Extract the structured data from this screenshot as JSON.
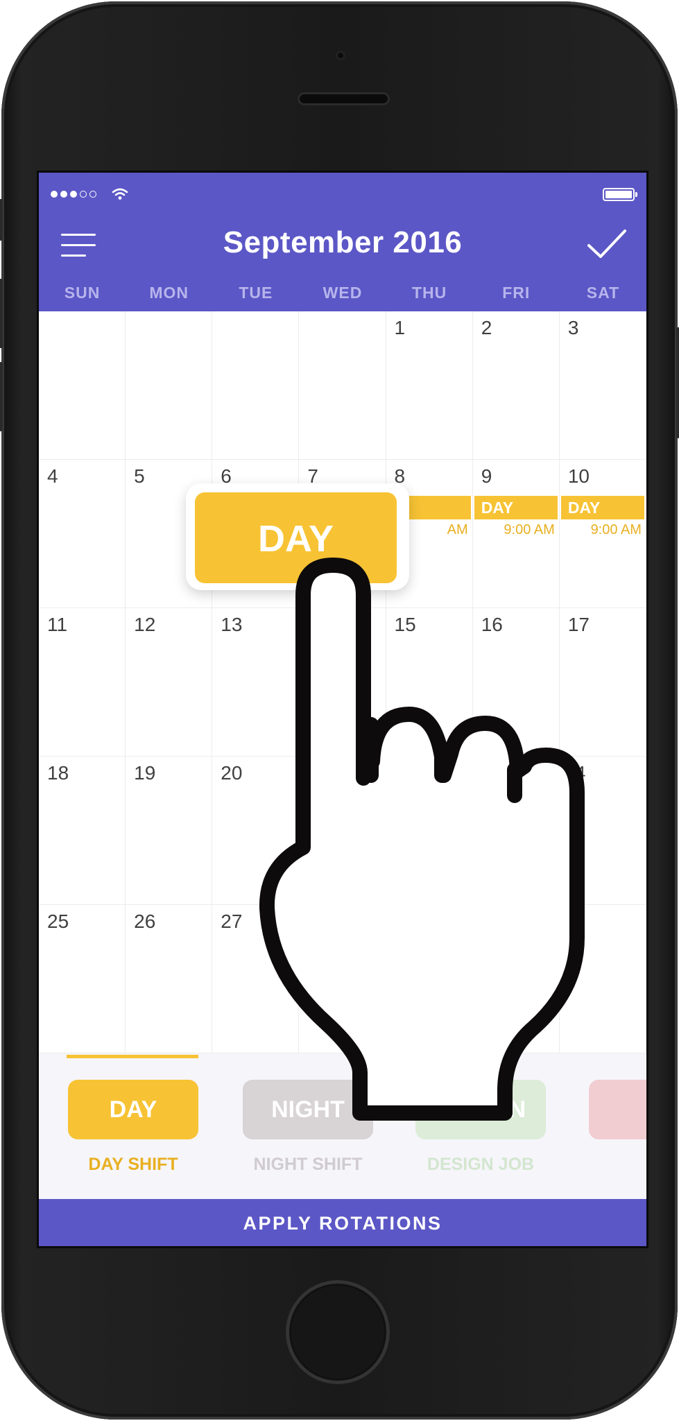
{
  "header": {
    "title": "September 2016",
    "weekdays": [
      "SUN",
      "MON",
      "TUE",
      "WED",
      "THU",
      "FRI",
      "SAT"
    ],
    "menu_icon": "hamburger-menu-icon",
    "confirm_icon": "checkmark-icon"
  },
  "status_bar": {
    "signal_icon": "signal-dots-icon",
    "wifi_icon": "wifi-icon",
    "battery_icon": "battery-icon",
    "battery_level": 1.0
  },
  "calendar": {
    "weeks": [
      [
        "",
        "",
        "",
        "",
        "1",
        "2",
        "3"
      ],
      [
        "4",
        "5",
        "6",
        "7",
        "8",
        "9",
        "10"
      ],
      [
        "11",
        "12",
        "13",
        "",
        "15",
        "16",
        "17"
      ],
      [
        "18",
        "19",
        "20",
        "",
        "",
        "",
        "4"
      ],
      [
        "25",
        "26",
        "27",
        "",
        "",
        "",
        ""
      ]
    ],
    "shifts": [
      {
        "label": "DAY",
        "time": "9:00 AM"
      },
      {
        "label": "DAY",
        "time": "9:00 AM"
      },
      {
        "partial_time": "AM"
      }
    ]
  },
  "drag": {
    "label": "DAY",
    "hand_icon": "pointing-hand-icon"
  },
  "tray": {
    "rotations": [
      {
        "chip": "DAY",
        "label": "DAY SHIFT",
        "color": "#f7c334",
        "label_color": "#e8b021"
      },
      {
        "chip": "NIGHT",
        "label": "NIGHT SHIFT",
        "color": "#d8d3d4",
        "label_color": "#cfcbd0"
      },
      {
        "chip": "DESIGN",
        "label": "DESIGN JOB",
        "color": "#dcecd8",
        "label_color": "#d3e6cf"
      },
      {
        "chip": "",
        "label": "",
        "color": "#f1cdd2",
        "label_color": "#f1cdd2"
      }
    ]
  },
  "apply_label": "APPLY ROTATIONS",
  "colors": {
    "accent": "#5b57c6",
    "day": "#f7c334"
  }
}
